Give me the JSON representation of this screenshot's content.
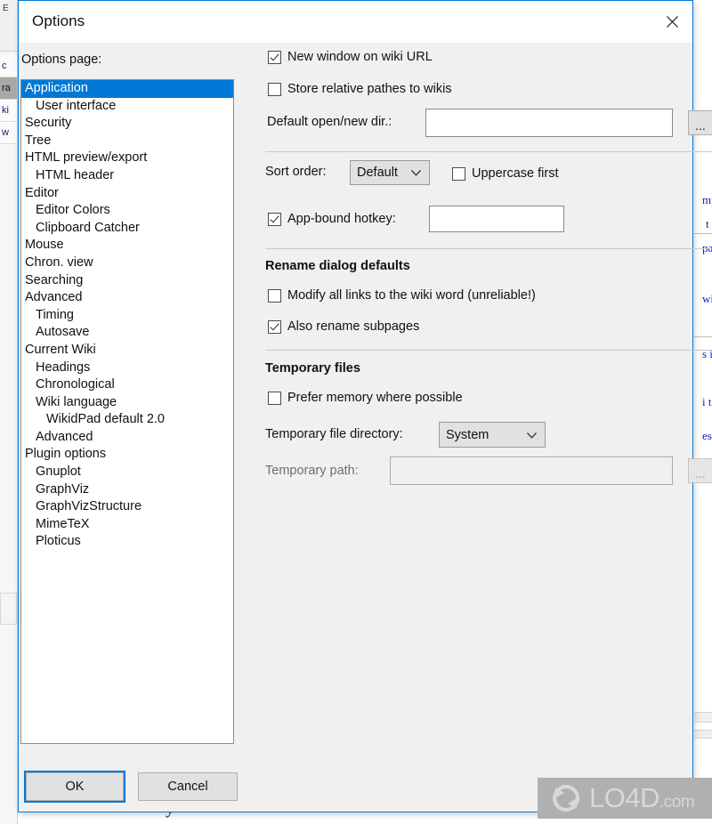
{
  "window": {
    "title": "Options",
    "close_icon": "close-icon"
  },
  "left": {
    "options_page_label": "Options page:",
    "items": [
      {
        "label": "Application",
        "indent": 0,
        "selected": true
      },
      {
        "label": "User interface",
        "indent": 1,
        "selected": false
      },
      {
        "label": "Security",
        "indent": 0,
        "selected": false
      },
      {
        "label": "Tree",
        "indent": 0,
        "selected": false
      },
      {
        "label": "HTML preview/export",
        "indent": 0,
        "selected": false
      },
      {
        "label": "HTML header",
        "indent": 1,
        "selected": false
      },
      {
        "label": "Editor",
        "indent": 0,
        "selected": false
      },
      {
        "label": "Editor Colors",
        "indent": 1,
        "selected": false
      },
      {
        "label": "Clipboard Catcher",
        "indent": 1,
        "selected": false
      },
      {
        "label": "Mouse",
        "indent": 0,
        "selected": false
      },
      {
        "label": "Chron. view",
        "indent": 0,
        "selected": false
      },
      {
        "label": "Searching",
        "indent": 0,
        "selected": false
      },
      {
        "label": "Advanced",
        "indent": 0,
        "selected": false
      },
      {
        "label": "Timing",
        "indent": 1,
        "selected": false
      },
      {
        "label": "Autosave",
        "indent": 1,
        "selected": false
      },
      {
        "label": "Current Wiki",
        "indent": 0,
        "selected": false
      },
      {
        "label": "Headings",
        "indent": 1,
        "selected": false
      },
      {
        "label": "Chronological",
        "indent": 1,
        "selected": false
      },
      {
        "label": "Wiki language",
        "indent": 1,
        "selected": false
      },
      {
        "label": "WikidPad default 2.0",
        "indent": 2,
        "selected": false
      },
      {
        "label": "Advanced",
        "indent": 1,
        "selected": false
      },
      {
        "label": "Plugin options",
        "indent": 0,
        "selected": false
      },
      {
        "label": "Gnuplot",
        "indent": 1,
        "selected": false
      },
      {
        "label": "GraphViz",
        "indent": 1,
        "selected": false
      },
      {
        "label": "GraphVizStructure",
        "indent": 1,
        "selected": false
      },
      {
        "label": "MimeTeX",
        "indent": 1,
        "selected": false
      },
      {
        "label": "Ploticus",
        "indent": 1,
        "selected": false
      }
    ]
  },
  "buttons": {
    "ok": "OK",
    "cancel": "Cancel"
  },
  "right": {
    "new_window_on_wiki_url": {
      "label": "New window on wiki URL",
      "checked": true
    },
    "store_relative_pathes": {
      "label": "Store relative pathes to wikis",
      "checked": false
    },
    "default_dir": {
      "label": "Default open/new dir.:",
      "value": "",
      "browse_label": "..."
    },
    "sort_order": {
      "label": "Sort order:",
      "value": "Default"
    },
    "uppercase_first": {
      "label": "Uppercase first",
      "checked": false
    },
    "app_bound_hotkey": {
      "label": "App-bound hotkey:",
      "checked": true,
      "value": ""
    },
    "rename_group": {
      "heading": "Rename dialog defaults",
      "modify_all_links": {
        "label": "Modify all links to the wiki word (unreliable!)",
        "checked": false
      },
      "also_rename_subpages": {
        "label": "Also rename subpages",
        "checked": true
      }
    },
    "temporary_group": {
      "heading": "Temporary files",
      "prefer_memory": {
        "label": "Prefer memory where possible",
        "checked": false
      },
      "temp_dir": {
        "label": "Temporary file directory:",
        "value": "System"
      },
      "temp_path": {
        "label": "Temporary path:",
        "value": "",
        "browse_label": "..."
      }
    }
  },
  "background": {
    "left_tabs": [
      "c",
      "ra",
      "ki",
      "w"
    ],
    "left_toolbar": "E",
    "right_fragments": [
      "mp",
      "t",
      "pa",
      "wi",
      "s i",
      "i t",
      "es"
    ],
    "bottom_text": "y"
  },
  "watermark": {
    "text": "LO4D",
    "suffix": ".com",
    "logo_icon": "refresh-circle-icon"
  },
  "colors": {
    "accent": "#0078d7",
    "dialog_bg": "#f0f0f0",
    "selection": "#0078d7",
    "watermark_bg": "#aeb0b2"
  }
}
